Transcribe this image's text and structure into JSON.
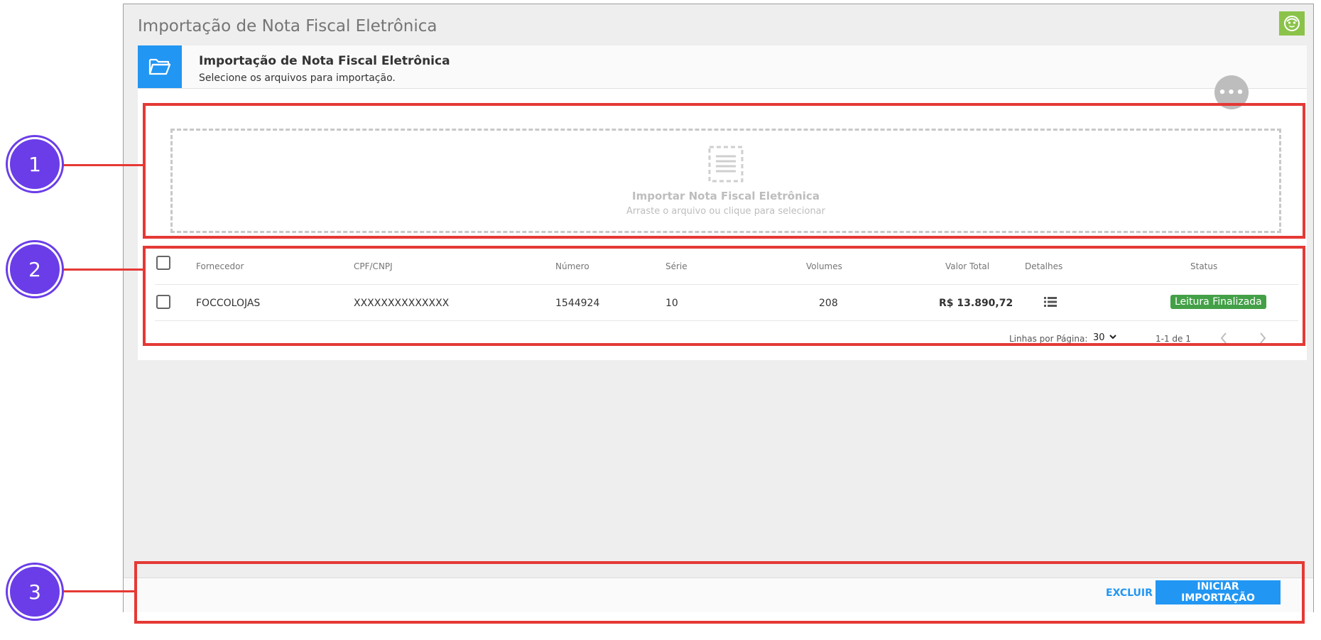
{
  "window": {
    "title": "Importação de Nota Fiscal Eletrônica"
  },
  "card": {
    "title": "Importação de Nota Fiscal Eletrônica",
    "subtitle": "Selecione os arquivos para importação."
  },
  "dropzone": {
    "title": "Importar Nota Fiscal Eletrônica",
    "subtitle": "Arraste o arquivo ou clique para selecionar"
  },
  "table": {
    "columns": [
      "Fornecedor",
      "CPF/CNPJ",
      "Número",
      "Série",
      "Volumes",
      "Valor Total",
      "Detalhes",
      "Status"
    ],
    "rows": [
      {
        "fornecedor": "FOCCOLOJAS",
        "cpf_cnpj": "XXXXXXXXXXXXXX",
        "numero": "1544924",
        "serie": "10",
        "volumes": "208",
        "valor_total": "R$ 13.890,72",
        "status": "Leitura Finalizada"
      }
    ]
  },
  "pagination": {
    "rows_per_page_label": "Linhas por Página:",
    "rows_per_page_value": "30",
    "range": "1-1 de 1"
  },
  "footer": {
    "delete_label": "EXCLUIR",
    "start_label": "INICIAR IMPORTAÇÃO"
  },
  "callouts": [
    "1",
    "2",
    "3"
  ],
  "colors": {
    "accent": "#2196f3",
    "status_success": "#43a047",
    "callout_red": "#e53935",
    "badge_purple": "#6a3de8",
    "face_button": "#8bc34a"
  },
  "icons": {
    "folder": "folder-open-icon",
    "face": "face-icon",
    "more": "more-horizontal-icon",
    "document": "document-icon",
    "details": "list-icon",
    "prev": "chevron-left-icon",
    "next": "chevron-right-icon",
    "caret": "caret-down-icon"
  }
}
